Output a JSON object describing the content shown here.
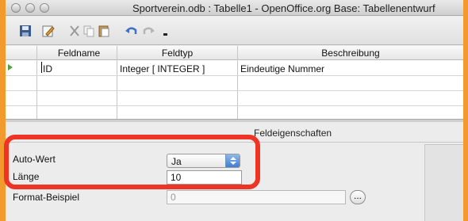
{
  "window": {
    "title": "Sportverein.odb : Tabelle1 - OpenOffice.org Base: Tabellenentwurf"
  },
  "toolbar": {
    "icons": [
      "save-icon",
      "edit-icon",
      "cut-icon",
      "copy-icon",
      "paste-icon",
      "undo-icon",
      "redo-icon",
      "dropdown-icon"
    ]
  },
  "table": {
    "columns": [
      "Feldname",
      "Feldtyp",
      "Beschreibung"
    ],
    "rows": [
      {
        "name": "ID",
        "type": "Integer [ INTEGER ]",
        "description": "Eindeutige Nummer"
      }
    ]
  },
  "properties": {
    "title": "Feldeigenschaften",
    "auto_value_label": "Auto-Wert",
    "auto_value": "Ja",
    "length_label": "Länge",
    "length_value": "10",
    "format_label": "Format-Beispiel",
    "format_value": "0",
    "ellipsis": "..."
  },
  "colors": {
    "accent_border": "#f29a2e",
    "highlight": "#ee3424",
    "row_marker": "#52a23d"
  }
}
